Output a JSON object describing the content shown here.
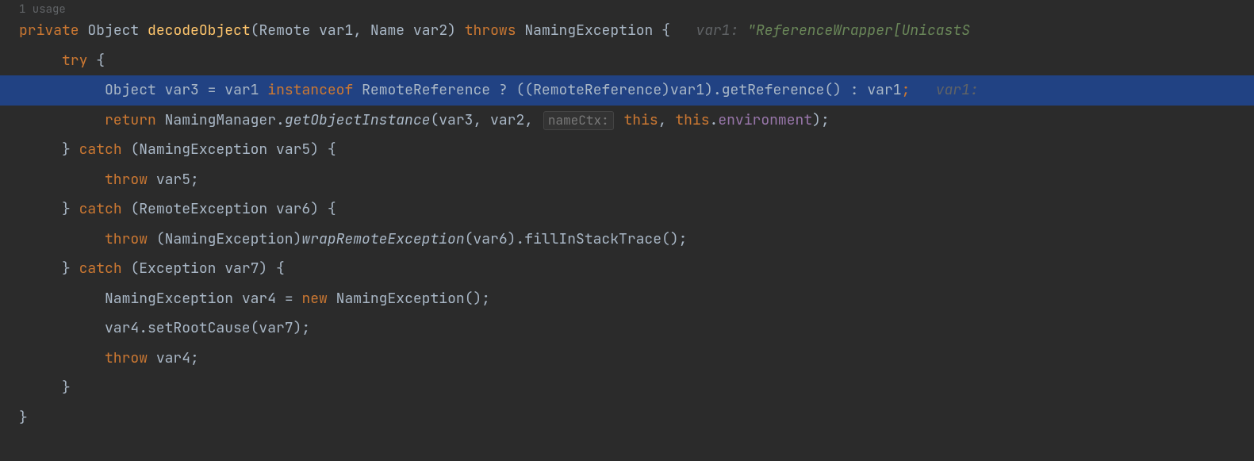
{
  "usage": "1 usage",
  "sig": {
    "mod": "private",
    "rettype": "Object",
    "name": "decodeObject",
    "p1type": "Remote",
    "p1name": "var1",
    "p2type": "Name",
    "p2name": "var2",
    "throws_kw": "throws",
    "throws_type": "NamingException",
    "hint_var": "var1: ",
    "hint_val": "\"ReferenceWrapper[UnicastS"
  },
  "l2": {
    "try": "try"
  },
  "l3": {
    "type": "Object",
    "var": "var3",
    "eq": "=",
    "lhs": "var1",
    "instof": "instanceof",
    "reftype": "RemoteReference",
    "q": "?",
    "cast": "((RemoteReference)var1).getReference()",
    "colon": ":",
    "rhs": "var1",
    "hint": "var1: "
  },
  "l4": {
    "ret": "return",
    "cls": "NamingManager",
    "dot": ".",
    "mth": "getObjectInstance",
    "args1": "(var3, var2,",
    "hintlabel": "nameCtx:",
    "this1": "this",
    "comma": ", ",
    "this2": "this",
    "dot2": ".",
    "env": "environment",
    "close": ");"
  },
  "l5": {
    "brace": "}",
    "catch": "catch",
    "open": "(NamingException var5) {"
  },
  "l6": {
    "throw": "throw",
    "var": "var5;"
  },
  "l7": {
    "brace": "}",
    "catch": "catch",
    "open": "(RemoteException var6) {"
  },
  "l8": {
    "throw": "throw",
    "cast": "(NamingException)",
    "wrap": "wrapRemoteException",
    "rest": "(var6).fillInStackTrace();"
  },
  "l9": {
    "brace": "}",
    "catch": "catch",
    "open": "(Exception var7) {"
  },
  "l10": {
    "type": "NamingException",
    "var": "var4",
    "eq": "=",
    "new": "new",
    "ctor": "NamingException();"
  },
  "l11": {
    "stmt": "var4.setRootCause(var7);"
  },
  "l12": {
    "throw": "throw",
    "var": "var4;"
  },
  "l13": {
    "brace": "}"
  },
  "l14": {
    "brace": "}"
  }
}
